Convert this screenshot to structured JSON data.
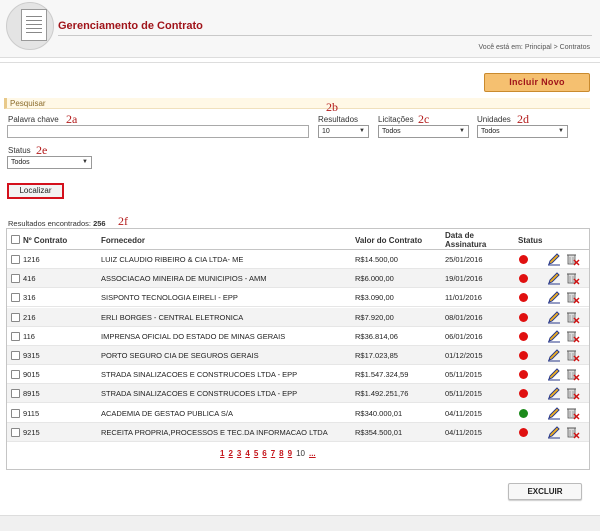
{
  "header": {
    "title": "Gerenciamento de Contrato",
    "breadcrumb": "Você está em: Principal > Contratos"
  },
  "toolbar": {
    "incluir_label": "Incluir Novo"
  },
  "search": {
    "section_label": "Pesquisar",
    "keyword_label": "Palavra chave",
    "resultados_label": "Resultados",
    "resultados_value": "10",
    "licitacoes_label": "Licitações",
    "licitacoes_value": "Todos",
    "unidades_label": "Unidades",
    "unidades_value": "Todos",
    "status_label": "Status",
    "status_value": "Todos",
    "localizar_label": "Localizar"
  },
  "annotations": {
    "a": "2a",
    "b": "2b",
    "c": "2c",
    "d": "2d",
    "e": "2e",
    "f": "2f"
  },
  "results": {
    "label": "Resultados encontrados:",
    "count": "256"
  },
  "table": {
    "headers": {
      "numero": "Nº Contrato",
      "fornecedor": "Fornecedor",
      "valor": "Valor do Contrato",
      "data": "Data de Assinatura",
      "status": "Status"
    },
    "rows": [
      {
        "numero": "1216",
        "fornecedor": "LUIZ CLAUDIO RIBEIRO & CIA LTDA- ME",
        "valor": "R$14.500,00",
        "data": "25/01/2016",
        "status": "red"
      },
      {
        "numero": "416",
        "fornecedor": "ASSOCIACAO MINEIRA DE MUNICIPIOS - AMM",
        "valor": "R$6.000,00",
        "data": "19/01/2016",
        "status": "red"
      },
      {
        "numero": "316",
        "fornecedor": "SISPONTO TECNOLOGIA EIRELI - EPP",
        "valor": "R$3.090,00",
        "data": "11/01/2016",
        "status": "red"
      },
      {
        "numero": "216",
        "fornecedor": "ERLI BORGES - CENTRAL ELETRONICA",
        "valor": "R$7.920,00",
        "data": "08/01/2016",
        "status": "red"
      },
      {
        "numero": "116",
        "fornecedor": "IMPRENSA OFICIAL DO ESTADO DE MINAS GERAIS",
        "valor": "R$36.814,06",
        "data": "06/01/2016",
        "status": "red"
      },
      {
        "numero": "9315",
        "fornecedor": "PORTO SEGURO CIA DE SEGUROS GERAIS",
        "valor": "R$17.023,85",
        "data": "01/12/2015",
        "status": "red"
      },
      {
        "numero": "9015",
        "fornecedor": "STRADA SINALIZACOES E CONSTRUCOES LTDA - EPP",
        "valor": "R$1.547.324,59",
        "data": "05/11/2015",
        "status": "red"
      },
      {
        "numero": "8915",
        "fornecedor": "STRADA SINALIZACOES E CONSTRUCOES LTDA - EPP",
        "valor": "R$1.492.251,76",
        "data": "05/11/2015",
        "status": "red"
      },
      {
        "numero": "9115",
        "fornecedor": "ACADEMIA DE GESTAO PUBLICA S/A",
        "valor": "R$340.000,01",
        "data": "04/11/2015",
        "status": "green"
      },
      {
        "numero": "9215",
        "fornecedor": "RECEITA PROPRIA,PROCESSOS E TEC.DA INFORMACAO LTDA",
        "valor": "R$354.500,01",
        "data": "04/11/2015",
        "status": "red"
      }
    ]
  },
  "pagination": {
    "pages": [
      "1",
      "2",
      "3",
      "4",
      "5",
      "6",
      "7",
      "8",
      "9"
    ],
    "current": "10",
    "more": "..."
  },
  "footer": {
    "excluir_label": "EXCLUIR"
  },
  "colors": {
    "brand": "#a0141a",
    "status_red": "#e01010",
    "status_green": "#1b8a1b"
  },
  "icons": {
    "edit": "pencil-icon",
    "delete": "trash-x-icon"
  }
}
